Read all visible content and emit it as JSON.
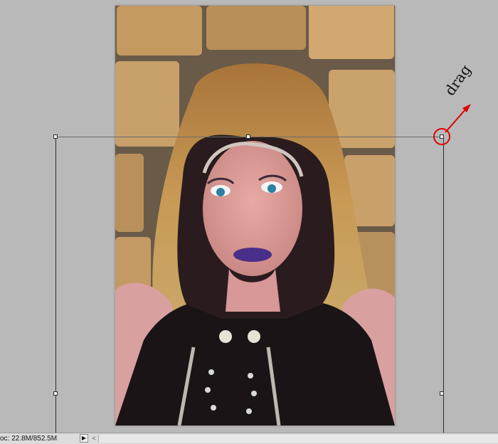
{
  "annotation": {
    "label": "drag",
    "color": "#e10000"
  },
  "status_bar": {
    "doc_size": "oc: 22.8M/852.5M",
    "menu_icon": "triangle-right-icon",
    "scroll_icon": "chevron-left-icon"
  },
  "canvas": {
    "background": "#b9b9b9",
    "image": "portrait-hooded-woman"
  }
}
